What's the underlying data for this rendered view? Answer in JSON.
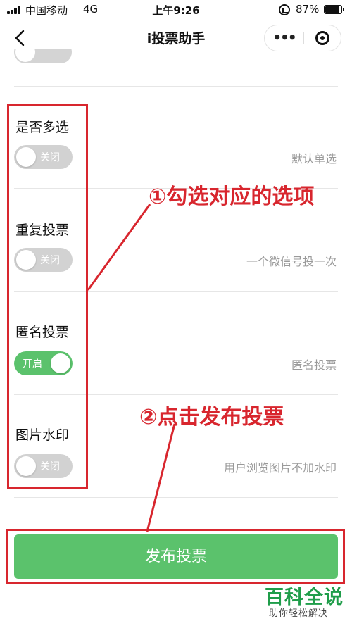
{
  "status_bar": {
    "carrier": "中国移动",
    "network": "4G",
    "time": "上午9:26",
    "battery_pct": "87%"
  },
  "nav": {
    "title": "i投票助手",
    "menu_icon": "•••"
  },
  "options": [
    {
      "label": "是否多选",
      "toggle_state": "off",
      "toggle_label": "关闭",
      "description": "默认单选"
    },
    {
      "label": "重复投票",
      "toggle_state": "off",
      "toggle_label": "关闭",
      "description": "一个微信号投一次"
    },
    {
      "label": "匿名投票",
      "toggle_state": "on",
      "toggle_label": "开启",
      "description": "匿名投票"
    },
    {
      "label": "图片水印",
      "toggle_state": "off",
      "toggle_label": "关闭",
      "description": "用户浏览图片不加水印"
    }
  ],
  "annotations": {
    "step1": "①勾选对应的选项",
    "step2": "②点击发布投票"
  },
  "publish_button": "发布投票",
  "watermark": {
    "title": "百科全说",
    "subtitle": "助你轻松解决"
  },
  "colors": {
    "accent_green": "#5bc26c",
    "annotation_red": "#d8262e",
    "watermark_green": "#1f9d4a"
  }
}
